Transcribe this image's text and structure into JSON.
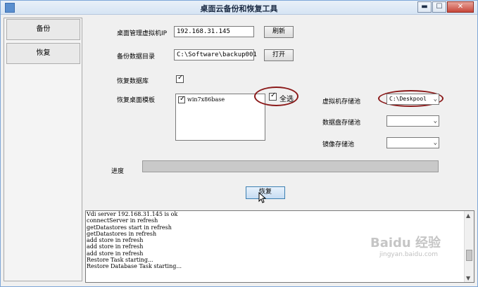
{
  "window": {
    "title": "桌面云备份和恢复工具",
    "min_label": "▬",
    "max_label": "☐",
    "close_label": "✕"
  },
  "sidebar": {
    "items": [
      {
        "label": "备份"
      },
      {
        "label": "恢复"
      }
    ]
  },
  "form": {
    "vm_ip_label": "桌面管理虚拟机IP",
    "vm_ip_value": "192.168.31.145",
    "refresh_label": "刷新",
    "backup_dir_label": "备份数据目录",
    "backup_dir_value": "C:\\Software\\backup001",
    "open_label": "打开",
    "restore_db_label": "恢复数据库",
    "restore_db_checked": "✓",
    "restore_template_label": "恢复桌面模板",
    "template_item_checked": "✓",
    "template_item": "win7x86base",
    "select_all_checked": "✓",
    "select_all_label": "全选",
    "vm_storage_label": "虚拟机存储池",
    "vm_storage_value": "C:\\Deskpool",
    "data_storage_label": "数据盘存储池",
    "data_storage_value": "",
    "image_storage_label": "镜像存储池",
    "image_storage_value": "",
    "progress_label": "进度",
    "progress_fraction": 0,
    "restore_button_label": "恢复"
  },
  "log": {
    "lines": [
      "Vdi server 192.168.31.145 is ok",
      "connectServer in refresh",
      "getDatastores start in refresh",
      "getDatastores in refresh",
      "add store in refresh",
      "add store in refresh",
      "add store in refresh",
      "Restore Task starting...",
      "Restore Database Task starting..."
    ]
  },
  "watermark": {
    "text": "Baidu 经验",
    "sub": "jingyan.baidu.com"
  },
  "colors": {
    "highlight_ellipse": "#8b1a1a",
    "close_button": "#c7473a"
  }
}
